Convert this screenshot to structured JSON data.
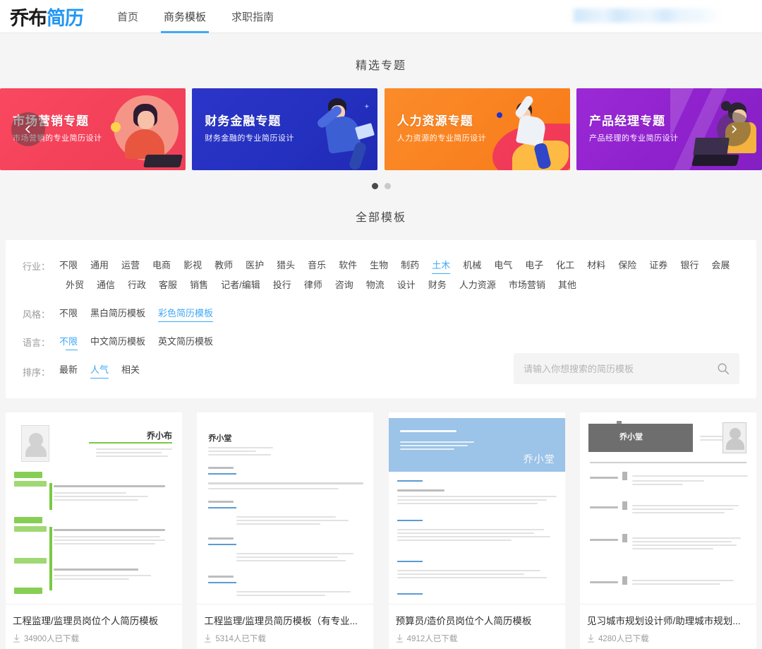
{
  "header": {
    "logo_dark": "乔布",
    "logo_blue": "简历",
    "nav": [
      {
        "label": "首页",
        "active": false
      },
      {
        "label": "商务模板",
        "active": true
      },
      {
        "label": "求职指南",
        "active": false
      }
    ]
  },
  "featured": {
    "title": "精选专题",
    "prev_icon": "chevron-left-icon",
    "next_icon": "chevron-right-icon",
    "banners": [
      {
        "title": "市场营销专题",
        "subtitle": "市场营销的专业简历设计",
        "color": "#f4415a"
      },
      {
        "title": "财务金融专题",
        "subtitle": "财务金融的专业简历设计",
        "color": "#2430bf"
      },
      {
        "title": "人力资源专题",
        "subtitle": "人力资源的专业简历设计",
        "color": "#f9811f"
      },
      {
        "title": "产品经理专题",
        "subtitle": "产品经理的专业简历设计",
        "color": "#8f22cd"
      }
    ],
    "dots": [
      {
        "active": true
      },
      {
        "active": false
      }
    ]
  },
  "all_templates": {
    "title": "全部模板"
  },
  "filters": {
    "accent_color": "#3fa9f5",
    "industry": {
      "label": "行业：",
      "options": [
        "不限",
        "通用",
        "运营",
        "电商",
        "影视",
        "教师",
        "医护",
        "猎头",
        "音乐",
        "软件",
        "生物",
        "制药",
        "土木",
        "机械",
        "电气",
        "电子",
        "化工",
        "材料",
        "保险",
        "证券",
        "银行",
        "会展",
        "外贸",
        "通信",
        "行政",
        "客服",
        "销售",
        "记者/编辑",
        "投行",
        "律师",
        "咨询",
        "物流",
        "设计",
        "财务",
        "人力资源",
        "市场营销",
        "其他"
      ],
      "selected": "土木"
    },
    "style": {
      "label": "风格：",
      "options": [
        "不限",
        "黑白简历模板",
        "彩色简历模板"
      ],
      "selected": "彩色简历模板"
    },
    "language": {
      "label": "语言：",
      "options": [
        "不限",
        "中文简历模板",
        "英文简历模板"
      ],
      "selected": "不限"
    },
    "sort": {
      "label": "排序：",
      "options": [
        "最新",
        "人气",
        "相关"
      ],
      "selected": "人气"
    },
    "search": {
      "placeholder": "请输入你想搜索的简历模板",
      "value": "",
      "icon": "search-icon"
    }
  },
  "templates": [
    {
      "title": "工程监理/监理员岗位个人简历模板",
      "downloads": "34900人已下载",
      "resume_name": "乔小布",
      "theme": "green"
    },
    {
      "title": "工程监理/监理员简历模板（有专业...",
      "downloads": "5314人已下载",
      "resume_name": "乔小堂",
      "theme": "white"
    },
    {
      "title": "预算员/造价员岗位个人简历模板",
      "downloads": "4912人已下载",
      "resume_name": "乔小堂",
      "theme": "blue"
    },
    {
      "title": "见习城市规划设计师/助理城市规划...",
      "downloads": "4280人已下载",
      "resume_name": "乔小堂",
      "theme": "gray"
    }
  ]
}
